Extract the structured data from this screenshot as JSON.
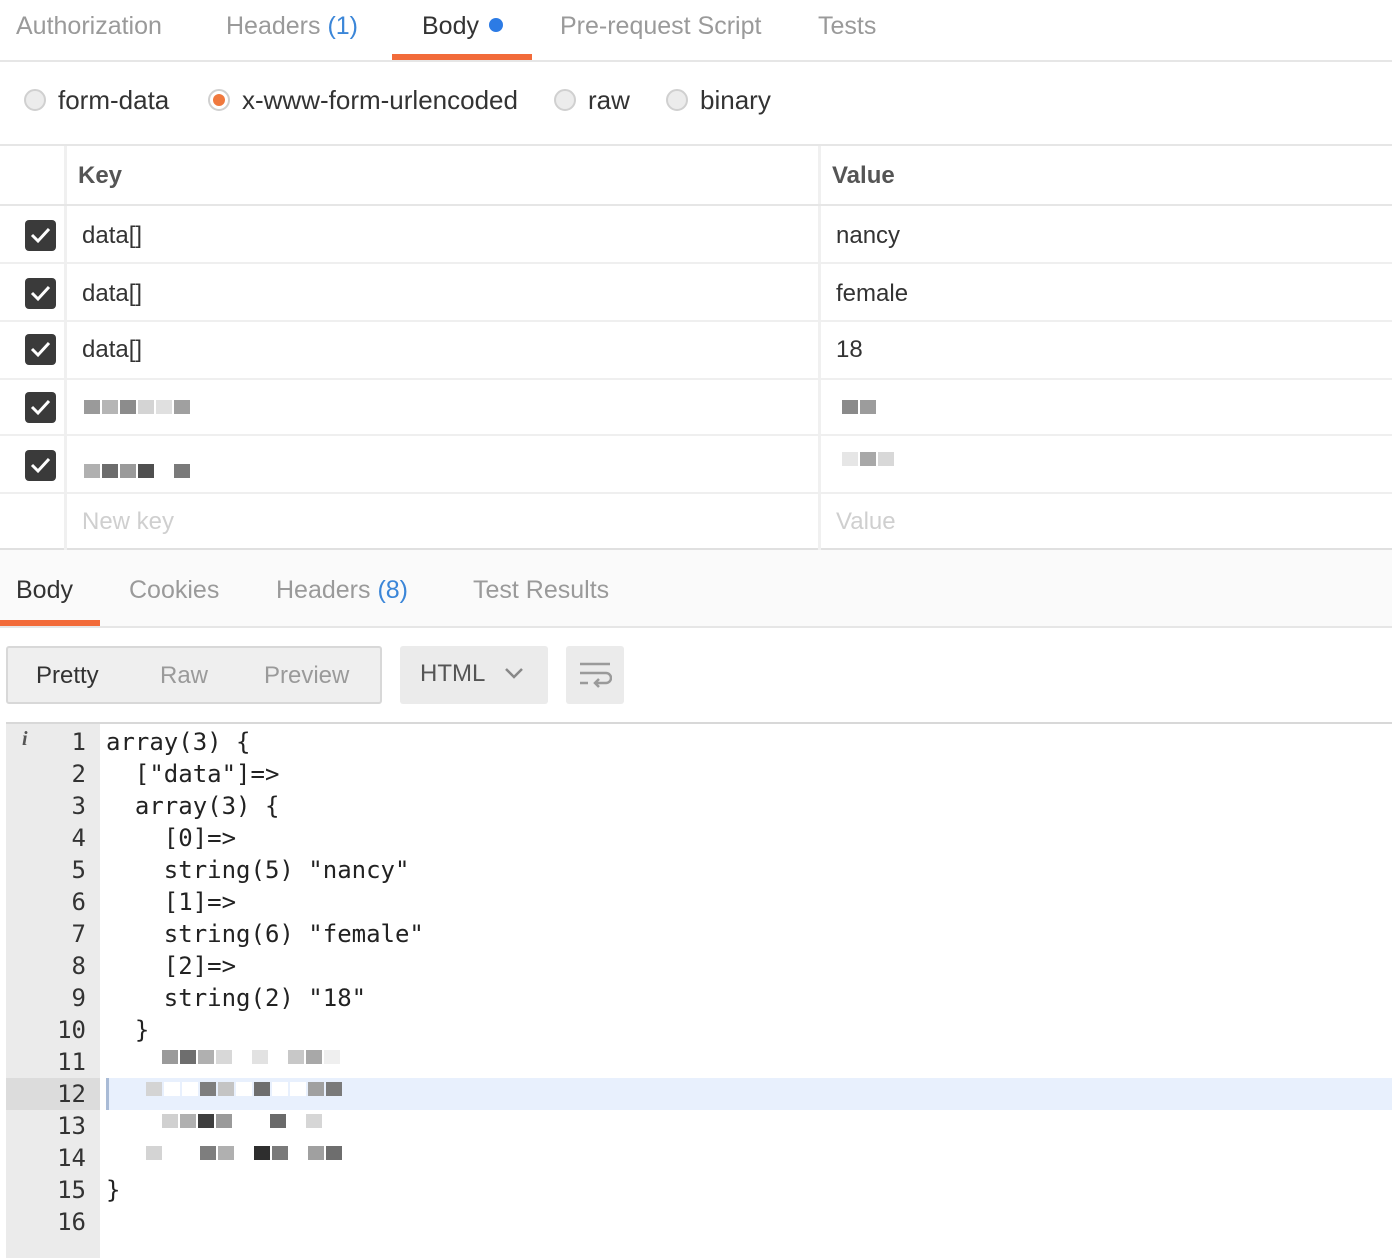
{
  "request_tabs": {
    "authorization": "Authorization",
    "headers_label": "Headers",
    "headers_count": "(1)",
    "body": "Body",
    "prerequest": "Pre-request Script",
    "tests": "Tests"
  },
  "body_types": [
    {
      "label": "form-data",
      "selected": false
    },
    {
      "label": "x-www-form-urlencoded",
      "selected": true
    },
    {
      "label": "raw",
      "selected": false
    },
    {
      "label": "binary",
      "selected": false
    }
  ],
  "table": {
    "key_header": "Key",
    "value_header": "Value",
    "rows": [
      {
        "key": "data[]",
        "value": "nancy",
        "checked": true
      },
      {
        "key": "data[]",
        "value": "female",
        "checked": true
      },
      {
        "key": "data[]",
        "value": "18",
        "checked": true
      }
    ],
    "new_key_placeholder": "New key",
    "new_value_placeholder": "Value"
  },
  "response_tabs": {
    "body": "Body",
    "cookies": "Cookies",
    "headers_label": "Headers",
    "headers_count": "(8)",
    "test_results": "Test Results"
  },
  "toolbar": {
    "pretty": "Pretty",
    "raw": "Raw",
    "preview": "Preview",
    "format": "HTML"
  },
  "code": {
    "lines": [
      "array(3) {",
      "  [\"data\"]=>",
      "  array(3) {",
      "    [0]=>",
      "    string(5) \"nancy\"",
      "    [1]=>",
      "    string(6) \"female\"",
      "    [2]=>",
      "    string(2) \"18\"",
      "  }",
      "",
      "",
      "",
      "",
      "}",
      ""
    ],
    "line_numbers": [
      "1",
      "2",
      "3",
      "4",
      "5",
      "6",
      "7",
      "8",
      "9",
      "10",
      "11",
      "12",
      "13",
      "14",
      "15",
      "16"
    ],
    "info_marker": "i"
  },
  "colors": {
    "accent": "#f26b3a",
    "link_blue": "#3b86d8",
    "dot_blue": "#2c7be5"
  }
}
